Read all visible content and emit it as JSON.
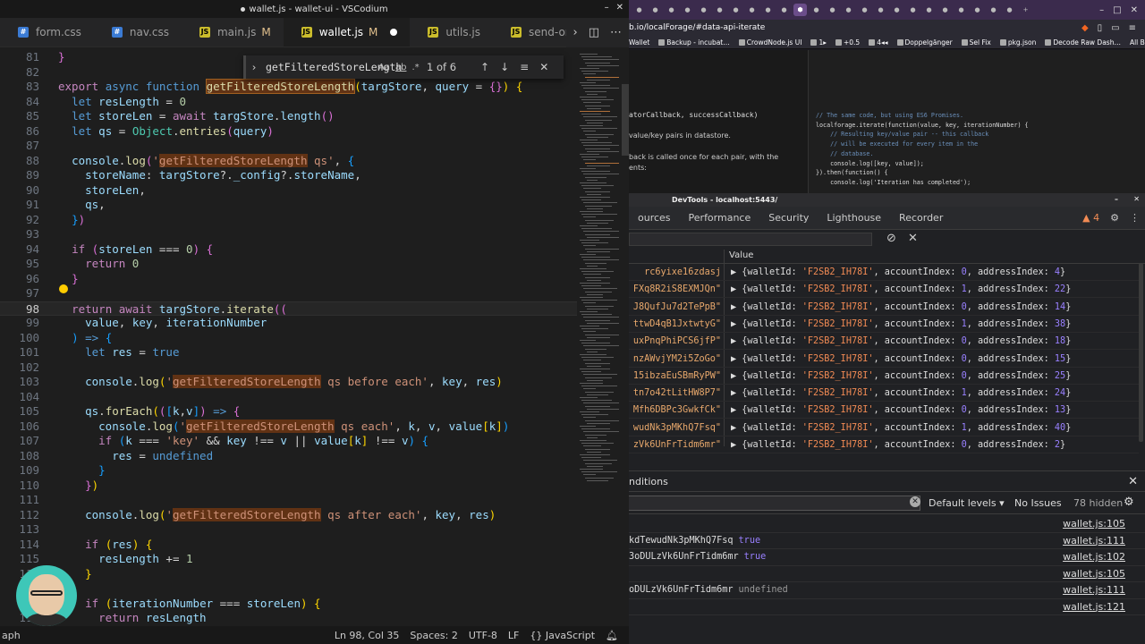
{
  "editor": {
    "title": "wallet.js - wallet-ui - VSCodium",
    "tabs": [
      {
        "label": "form.css",
        "type": "css",
        "mod": "",
        "active": false
      },
      {
        "label": "nav.css",
        "type": "css",
        "mod": "",
        "active": false
      },
      {
        "label": "main.js",
        "type": "js",
        "mod": "M",
        "active": false
      },
      {
        "label": "wallet.js",
        "type": "js",
        "mod": "M",
        "active": true
      },
      {
        "label": "utils.js",
        "type": "js",
        "mod": "",
        "active": false
      },
      {
        "label": "send-or-requ",
        "type": "js",
        "mod": "",
        "active": false
      }
    ],
    "find": {
      "query": "getFilteredStoreLength",
      "opt_case": "Aa",
      "opt_word": "ab",
      "opt_regex": ".*",
      "count": "1 of 6"
    },
    "line_numbers": [
      "81",
      "82",
      "83",
      "84",
      "85",
      "86",
      "87",
      "88",
      "89",
      "90",
      "91",
      "92",
      "93",
      "94",
      "95",
      "96",
      "97",
      "98",
      "99",
      "100",
      "101",
      "102",
      "103",
      "104",
      "105",
      "106",
      "107",
      "108",
      "109",
      "110",
      "111",
      "112",
      "113",
      "114",
      "115",
      "116",
      "117",
      "118",
      "119"
    ],
    "status": {
      "left": "aph",
      "position": "Ln 98, Col 35",
      "spaces": "Spaces: 2",
      "encoding": "UTF-8",
      "eol": "LF",
      "language": "JavaScript"
    }
  },
  "browser": {
    "url": "b.io/localForage/#data-api-iterate",
    "bookmarks": [
      "Wallet",
      "Backup - incubat…",
      "CrowdNode.js UI",
      "1▸",
      "+0.5",
      "4◂◂",
      "Doppelgänger",
      "Sel Fix",
      "pkg.json",
      "Decode Raw Dash…"
    ],
    "all_bookmarks": "All Bookmarks",
    "doc_left": {
      "signature": "atorCallback, successCallback)",
      "p1": "value/key pairs in datastore.",
      "p2": "back is called once for each pair, with the\nents:"
    },
    "doc_code": [
      "// The same code, but using ES6 Promises.",
      "localforage.iterate(function(value, key, iterationNumber) {",
      "    // Resulting key/value pair -- this callback",
      "    // will be executed for every item in the",
      "    // database.",
      "    console.log([key, value]);",
      "}).then(function() {",
      "    console.log('Iteration has completed');"
    ]
  },
  "devtools": {
    "title": "DevTools - localhost:5443/",
    "tabs": [
      "ources",
      "Performance",
      "Security",
      "Lighthouse",
      "Recorder"
    ],
    "warning_count": "4",
    "value_header": "Value",
    "rows": [
      {
        "key": "rc6yixe16zdasj",
        "acct": "0",
        "addr": "4"
      },
      {
        "key": "FXq8R2iS8EXMJQn\"",
        "acct": "1",
        "addr": "22"
      },
      {
        "key": "J8QufJu7d2TePpB\"",
        "acct": "0",
        "addr": "14"
      },
      {
        "key": "ttwD4qB1JxtwtyG\"",
        "acct": "1",
        "addr": "38"
      },
      {
        "key": "uxPnqPhiPCS6jfP\"",
        "acct": "0",
        "addr": "18"
      },
      {
        "key": "nzAWvjYM2i5ZoGo\"",
        "acct": "0",
        "addr": "15"
      },
      {
        "key": "15ibzaEuSBmRyPW\"",
        "acct": "0",
        "addr": "25"
      },
      {
        "key": "tn7o42tLitHW8P7\"",
        "acct": "1",
        "addr": "24"
      },
      {
        "key": "Mfh6DBPc3GwkfCk\"",
        "acct": "0",
        "addr": "13"
      },
      {
        "key": "wudNk3pMKhQ7Fsq\"",
        "acct": "1",
        "addr": "40"
      },
      {
        "key": "zVk6UnFrTidm6mr\"",
        "acct": "0",
        "addr": "2"
      }
    ],
    "wallet_id": "'F2SB2_IH78I'",
    "drawer_title": "nditions",
    "default_levels": "Default levels ▾",
    "no_issues": "No Issues",
    "hidden": "78 hidden",
    "console_rows": [
      {
        "text": "",
        "extra": "",
        "kind": "",
        "src": "wallet.js:105"
      },
      {
        "text": "kdTewudNk3pMKhQ7Fsq",
        "extra": "true",
        "kind": "bool",
        "src": "wallet.js:111"
      },
      {
        "text": "3oDULzVk6UnFrTidm6mr",
        "extra": "true",
        "kind": "bool",
        "src": "wallet.js:102"
      },
      {
        "text": "",
        "extra": "",
        "kind": "",
        "src": "wallet.js:105"
      },
      {
        "text": "oDULzVk6UnFrTidm6mr",
        "extra": "undefined",
        "kind": "und",
        "src": "wallet.js:111"
      },
      {
        "text": "",
        "extra": "",
        "kind": "",
        "src": "wallet.js:121"
      }
    ]
  }
}
